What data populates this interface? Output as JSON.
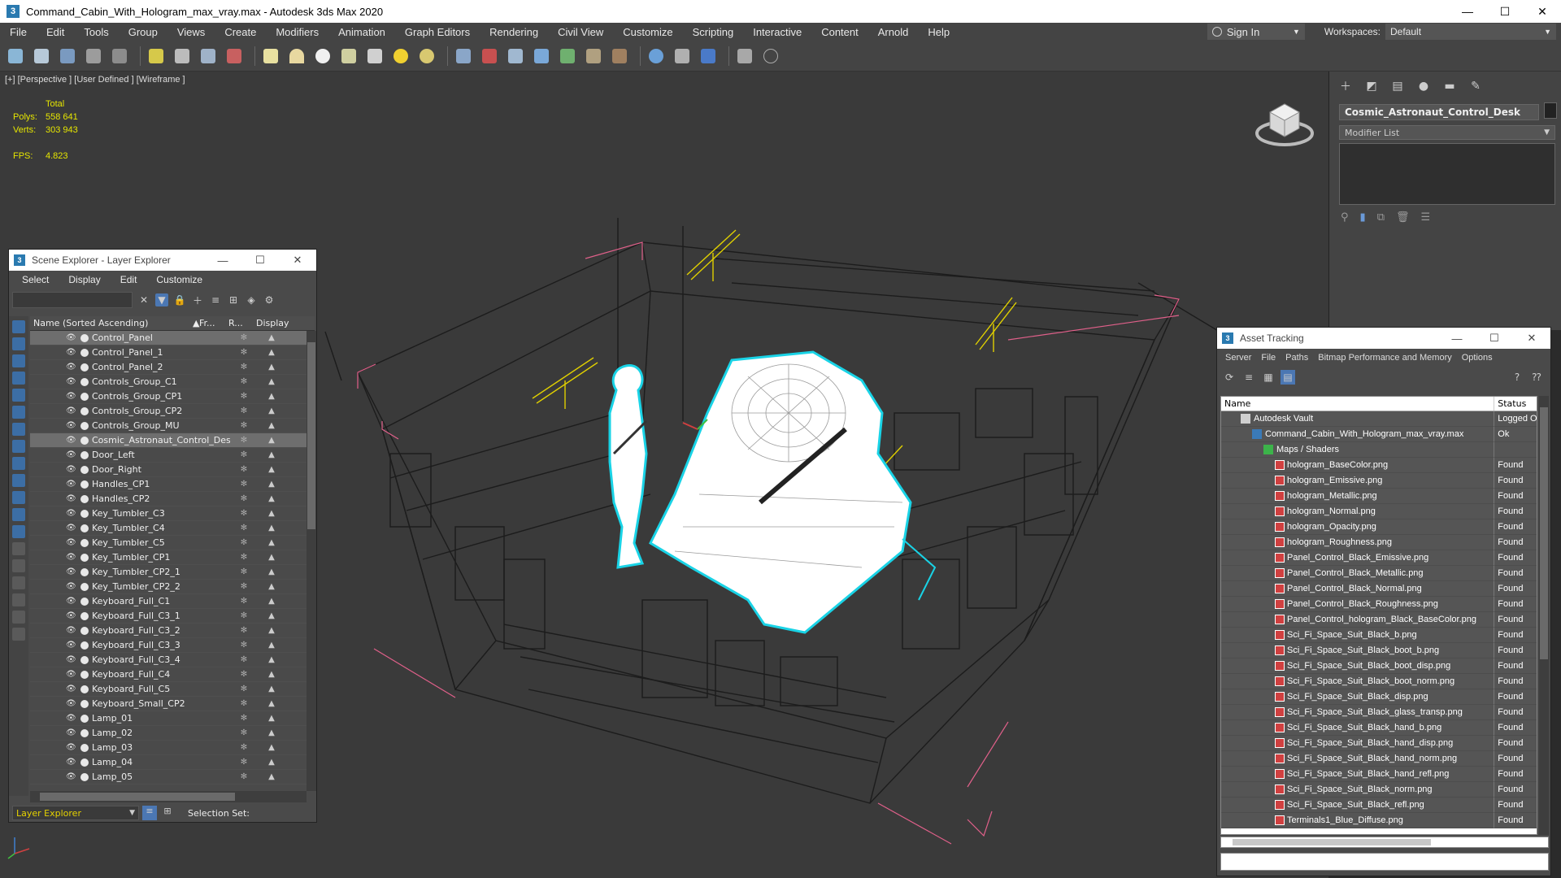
{
  "window": {
    "title": "Command_Cabin_With_Hologram_max_vray.max - Autodesk 3ds Max 2020",
    "app_icon": "3",
    "minimize": "—",
    "maximize": "☐",
    "close": "✕"
  },
  "menu": {
    "items": [
      "File",
      "Edit",
      "Tools",
      "Group",
      "Views",
      "Create",
      "Modifiers",
      "Animation",
      "Graph Editors",
      "Rendering",
      "Civil View",
      "Customize",
      "Scripting",
      "Interactive",
      "Content",
      "Arnold",
      "Help"
    ],
    "sign_in": "Sign In",
    "workspaces_label": "Workspaces:",
    "workspace_value": "Default"
  },
  "viewport": {
    "label": "[+] [Perspective ] [User Defined ] [Wireframe ]",
    "stats": {
      "total_label": "Total",
      "polys_label": "Polys:",
      "polys_value": "558 641",
      "verts_label": "Verts:",
      "verts_value": "303 943",
      "fps_label": "FPS:",
      "fps_value": "4.823"
    }
  },
  "command_panel": {
    "object_name": "Cosmic_Astronaut_Control_Desk",
    "modifier_list": "Modifier List"
  },
  "scene_explorer": {
    "title": "Scene Explorer - Layer Explorer",
    "icon": "3",
    "menu": [
      "Select",
      "Display",
      "Edit",
      "Customize"
    ],
    "columns": {
      "name": "Name (Sorted Ascending)",
      "frozen": "Fr...",
      "render": "R...",
      "display": "Display"
    },
    "rows": [
      {
        "name": "Control_Panel",
        "selected": true
      },
      {
        "name": "Control_Panel_1",
        "selected": false
      },
      {
        "name": "Control_Panel_2",
        "selected": false
      },
      {
        "name": "Controls_Group_C1",
        "selected": false
      },
      {
        "name": "Controls_Group_CP1",
        "selected": false
      },
      {
        "name": "Controls_Group_CP2",
        "selected": false
      },
      {
        "name": "Controls_Group_MU",
        "selected": false
      },
      {
        "name": "Cosmic_Astronaut_Control_Desk",
        "selected": true
      },
      {
        "name": "Door_Left",
        "selected": false
      },
      {
        "name": "Door_Right",
        "selected": false
      },
      {
        "name": "Handles_CP1",
        "selected": false
      },
      {
        "name": "Handles_CP2",
        "selected": false
      },
      {
        "name": "Key_Tumbler_C3",
        "selected": false
      },
      {
        "name": "Key_Tumbler_C4",
        "selected": false
      },
      {
        "name": "Key_Tumbler_C5",
        "selected": false
      },
      {
        "name": "Key_Tumbler_CP1",
        "selected": false
      },
      {
        "name": "Key_Tumbler_CP2_1",
        "selected": false
      },
      {
        "name": "Key_Tumbler_CP2_2",
        "selected": false
      },
      {
        "name": "Keyboard_Full_C1",
        "selected": false
      },
      {
        "name": "Keyboard_Full_C3_1",
        "selected": false
      },
      {
        "name": "Keyboard_Full_C3_2",
        "selected": false
      },
      {
        "name": "Keyboard_Full_C3_3",
        "selected": false
      },
      {
        "name": "Keyboard_Full_C3_4",
        "selected": false
      },
      {
        "name": "Keyboard_Full_C4",
        "selected": false
      },
      {
        "name": "Keyboard_Full_C5",
        "selected": false
      },
      {
        "name": "Keyboard_Small_CP2",
        "selected": false
      },
      {
        "name": "Lamp_01",
        "selected": false
      },
      {
        "name": "Lamp_02",
        "selected": false
      },
      {
        "name": "Lamp_03",
        "selected": false
      },
      {
        "name": "Lamp_04",
        "selected": false
      },
      {
        "name": "Lamp_05",
        "selected": false
      }
    ],
    "footer": {
      "layer_dropdown": "Layer Explorer",
      "selection_set": "Selection Set:"
    }
  },
  "asset_tracking": {
    "title": "Asset Tracking",
    "icon": "3",
    "menu": [
      "Server",
      "File",
      "Paths",
      "Bitmap Performance and Memory",
      "Options"
    ],
    "columns": {
      "name": "Name",
      "status": "Status"
    },
    "rows": [
      {
        "indent": 1,
        "icon": "folder",
        "name": "Autodesk Vault",
        "status": "Logged Out"
      },
      {
        "indent": 2,
        "icon": "max",
        "name": "Command_Cabin_With_Hologram_max_vray.max",
        "status": "Ok"
      },
      {
        "indent": 3,
        "icon": "maps",
        "name": "Maps / Shaders",
        "status": ""
      },
      {
        "indent": 4,
        "icon": "png",
        "name": "hologram_BaseColor.png",
        "status": "Found"
      },
      {
        "indent": 4,
        "icon": "png",
        "name": "hologram_Emissive.png",
        "status": "Found"
      },
      {
        "indent": 4,
        "icon": "png",
        "name": "hologram_Metallic.png",
        "status": "Found"
      },
      {
        "indent": 4,
        "icon": "png",
        "name": "hologram_Normal.png",
        "status": "Found"
      },
      {
        "indent": 4,
        "icon": "png",
        "name": "hologram_Opacity.png",
        "status": "Found"
      },
      {
        "indent": 4,
        "icon": "png",
        "name": "hologram_Roughness.png",
        "status": "Found"
      },
      {
        "indent": 4,
        "icon": "png",
        "name": "Panel_Control_Black_Emissive.png",
        "status": "Found"
      },
      {
        "indent": 4,
        "icon": "png",
        "name": "Panel_Control_Black_Metallic.png",
        "status": "Found"
      },
      {
        "indent": 4,
        "icon": "png",
        "name": "Panel_Control_Black_Normal.png",
        "status": "Found"
      },
      {
        "indent": 4,
        "icon": "png",
        "name": "Panel_Control_Black_Roughness.png",
        "status": "Found"
      },
      {
        "indent": 4,
        "icon": "png",
        "name": "Panel_Control_hologram_Black_BaseColor.png",
        "status": "Found"
      },
      {
        "indent": 4,
        "icon": "png",
        "name": "Sci_Fi_Space_Suit_Black_b.png",
        "status": "Found"
      },
      {
        "indent": 4,
        "icon": "png",
        "name": "Sci_Fi_Space_Suit_Black_boot_b.png",
        "status": "Found"
      },
      {
        "indent": 4,
        "icon": "png",
        "name": "Sci_Fi_Space_Suit_Black_boot_disp.png",
        "status": "Found"
      },
      {
        "indent": 4,
        "icon": "png",
        "name": "Sci_Fi_Space_Suit_Black_boot_norm.png",
        "status": "Found"
      },
      {
        "indent": 4,
        "icon": "png",
        "name": "Sci_Fi_Space_Suit_Black_disp.png",
        "status": "Found"
      },
      {
        "indent": 4,
        "icon": "png",
        "name": "Sci_Fi_Space_Suit_Black_glass_transp.png",
        "status": "Found"
      },
      {
        "indent": 4,
        "icon": "png",
        "name": "Sci_Fi_Space_Suit_Black_hand_b.png",
        "status": "Found"
      },
      {
        "indent": 4,
        "icon": "png",
        "name": "Sci_Fi_Space_Suit_Black_hand_disp.png",
        "status": "Found"
      },
      {
        "indent": 4,
        "icon": "png",
        "name": "Sci_Fi_Space_Suit_Black_hand_norm.png",
        "status": "Found"
      },
      {
        "indent": 4,
        "icon": "png",
        "name": "Sci_Fi_Space_Suit_Black_hand_refl.png",
        "status": "Found"
      },
      {
        "indent": 4,
        "icon": "png",
        "name": "Sci_Fi_Space_Suit_Black_norm.png",
        "status": "Found"
      },
      {
        "indent": 4,
        "icon": "png",
        "name": "Sci_Fi_Space_Suit_Black_refl.png",
        "status": "Found"
      },
      {
        "indent": 4,
        "icon": "png",
        "name": "Terminals1_Blue_Diffuse.png",
        "status": "Found"
      }
    ]
  },
  "colors": {
    "viewport_bg": "#3a3a3a",
    "wire_dark": "#1a1a1a",
    "wire_selected": "#ffffff",
    "selection_outline": "#19d3e6",
    "bbox_pink": "#e0608a",
    "light_yellow": "#e0d000",
    "stats_yellow": "#e6e600"
  }
}
